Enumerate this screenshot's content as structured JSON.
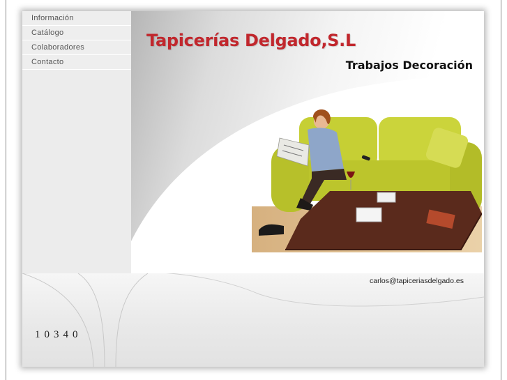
{
  "nav": {
    "items": [
      {
        "label": "Información"
      },
      {
        "label": "Catálogo"
      },
      {
        "label": "Colaboradores"
      },
      {
        "label": "Contacto"
      }
    ]
  },
  "header": {
    "title": "Tapicerías Delgado,S.L",
    "tagline": "Trabajos Decoración",
    "title_color": "#c1272d"
  },
  "contact": {
    "email": "carlos@tapiceriasdelgado.es"
  },
  "footer": {
    "visit_counter": "10340"
  },
  "colors": {
    "sofa": "#c9d23a",
    "table": "#5a2a1c",
    "floor": "#d9b98a"
  }
}
